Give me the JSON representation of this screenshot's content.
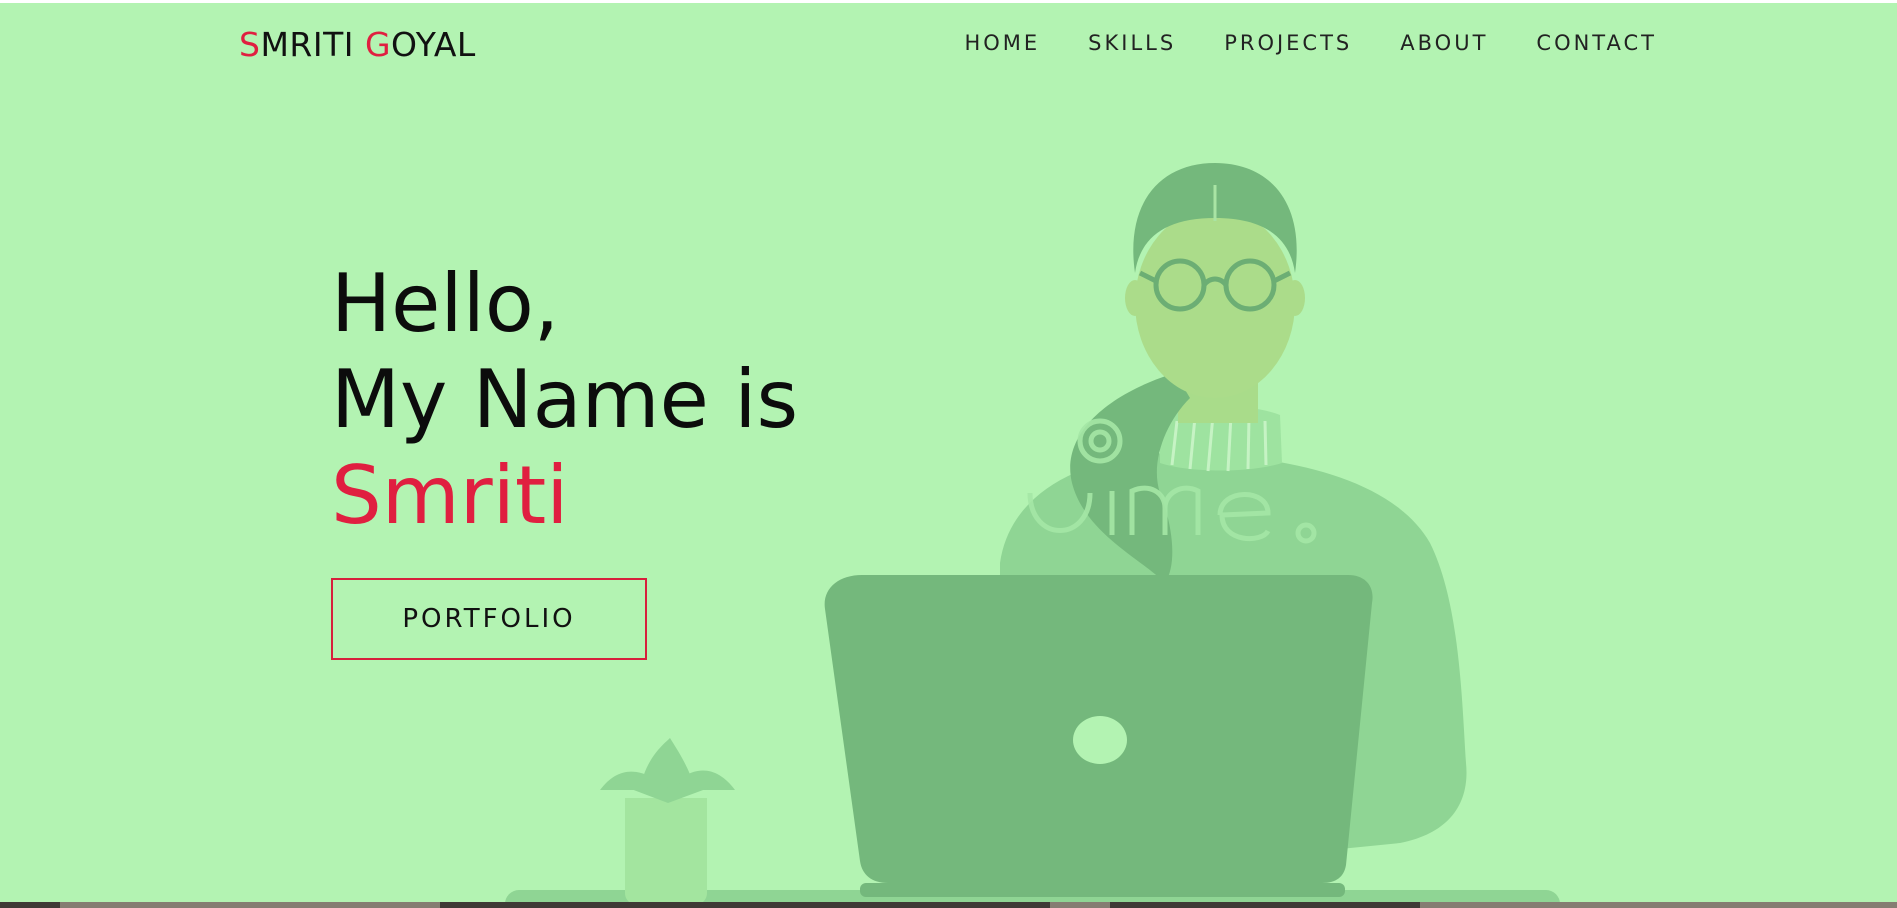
{
  "brand": {
    "first_initial": "S",
    "first_rest": "MRITI ",
    "last_initial": "G",
    "last_rest": "OYAL"
  },
  "nav": {
    "items": [
      "HOME",
      "SKILLS",
      "PROJECTS",
      "ABOUT",
      "CONTACT"
    ]
  },
  "hero": {
    "line1": "Hello,",
    "line2": "My Name is",
    "name": "Smriti",
    "cta_label": "PORTFOLIO"
  },
  "colors": {
    "background": "#b3f3b2",
    "accent": "#e01f40",
    "text": "#0c0c0c",
    "illustration_dark": "#74b87c",
    "illustration_mid": "#8fd594"
  },
  "icons": {
    "hero_image": "woman-at-laptop-illustration",
    "plant": "potted-plant-illustration"
  }
}
